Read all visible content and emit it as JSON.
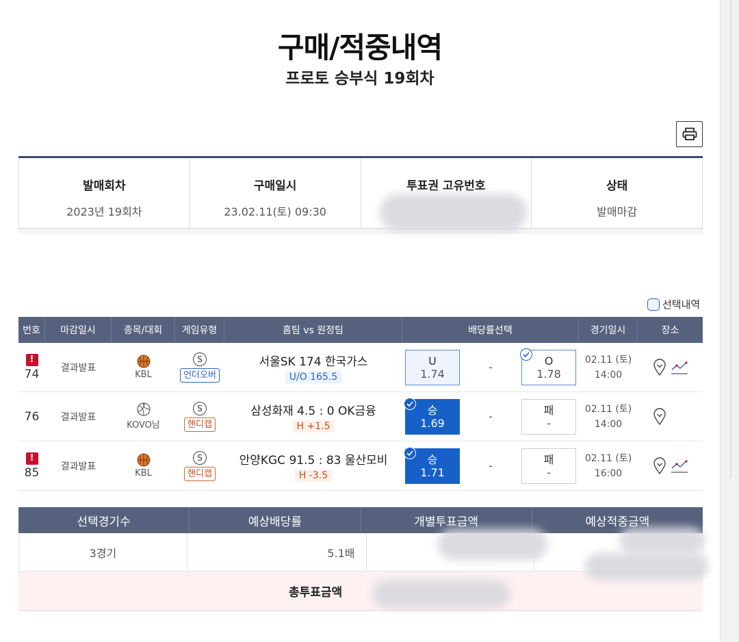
{
  "page": {
    "title": "구매/적중내역",
    "subtitle": "프로토 승부식 19회차"
  },
  "info": [
    {
      "label": "발매회차",
      "value": "2023년 19회차"
    },
    {
      "label": "구매일시",
      "value": "23.02.11(토) 09:30"
    },
    {
      "label": "투표권 고유번호",
      "value": ""
    },
    {
      "label": "상태",
      "value": "발매마감"
    }
  ],
  "select_history_label": "선택내역",
  "games_header": [
    "번호",
    "마감일시",
    "종목/대회",
    "게임유형",
    "홈팀 vs 원정팀",
    "배당률선택",
    "경기일시",
    "장소"
  ],
  "games": [
    {
      "num": "74",
      "warn": "!",
      "deadline": "결과발표",
      "league": "KBL",
      "sport": "basketball-icon",
      "s": "S",
      "type": "언더오버",
      "type_kind": "ou",
      "match": "서울SK  174  한국가스",
      "line": "U/O 165.5",
      "line_kind": "ou",
      "left_odd": {
        "label": "U",
        "value": "1.74"
      },
      "mid": "-",
      "right_odd": {
        "label": "O",
        "value": "1.78"
      },
      "date": "02.11 (토)",
      "time": "14:00"
    },
    {
      "num": "76",
      "warn": "",
      "deadline": "결과발표",
      "league": "KOVO남",
      "sport": "volleyball-icon",
      "s": "S",
      "type": "핸디캡",
      "type_kind": "hd",
      "match": "삼성화재 4.5 : 0 OK금융",
      "line": "H +1.5",
      "line_kind": "h",
      "left_odd": {
        "label": "승",
        "value": "1.69"
      },
      "mid": "-",
      "right_odd": {
        "label": "패",
        "value": "-"
      },
      "date": "02.11 (토)",
      "time": "14:00"
    },
    {
      "num": "85",
      "warn": "!",
      "deadline": "결과발표",
      "league": "KBL",
      "sport": "basketball-icon",
      "s": "S",
      "type": "핸디캡",
      "type_kind": "hd",
      "match": "안양KGC 91.5 : 83 울산모비",
      "line": "H -3.5",
      "line_kind": "h",
      "left_odd": {
        "label": "승",
        "value": "1.71"
      },
      "mid": "-",
      "right_odd": {
        "label": "패",
        "value": "-"
      },
      "date": "02.11 (토)",
      "time": "16:00"
    }
  ],
  "summary": {
    "headers": [
      "선택경기수",
      "예상배당률",
      "개별투표금액",
      "예상적중금액"
    ],
    "values": [
      "3경기",
      "5.1배",
      "",
      ""
    ],
    "total_label": "총투표금액"
  },
  "colors": {
    "header_bg": "#56627d",
    "selected_odd": "#1660c8",
    "warning": "#c8102e"
  }
}
